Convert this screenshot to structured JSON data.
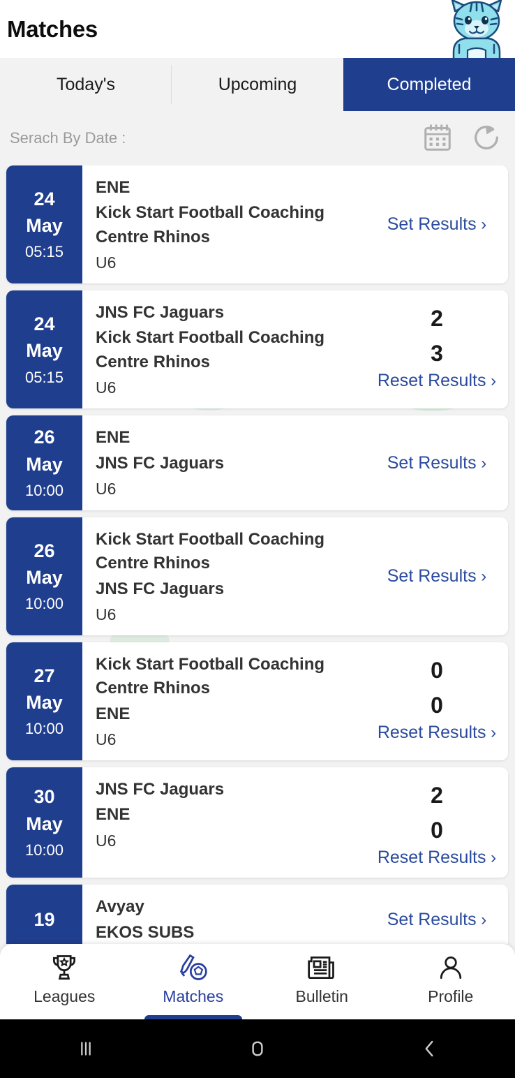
{
  "header": {
    "title": "Matches",
    "mascot_icon": "tiger-mascot-icon"
  },
  "tabs": [
    {
      "label": "Today's",
      "active": false
    },
    {
      "label": "Upcoming",
      "active": false
    },
    {
      "label": "Completed",
      "active": true
    }
  ],
  "search": {
    "label": "Serach By Date :",
    "calendar_icon": "calendar-icon",
    "refresh_icon": "refresh-icon"
  },
  "colors": {
    "primary_blue": "#1f3e8e",
    "link_blue": "#2a4a9e",
    "page_bg": "#f2f2f2",
    "card_bg": "#ffffff",
    "text_dark": "#333333"
  },
  "matches": [
    {
      "day": "24",
      "month": "May",
      "time": "05:15",
      "team_home": "ENE",
      "team_away": "Kick Start Football Coaching Centre Rhinos",
      "category": "U6",
      "score_home": null,
      "score_away": null,
      "action": "Set Results"
    },
    {
      "day": "24",
      "month": "May",
      "time": "05:15",
      "team_home": "JNS FC Jaguars",
      "team_away": "Kick Start Football Coaching Centre Rhinos",
      "category": "U6",
      "score_home": "2",
      "score_away": "3",
      "action": "Reset Results"
    },
    {
      "day": "26",
      "month": "May",
      "time": "10:00",
      "team_home": "ENE",
      "team_away": "JNS FC Jaguars",
      "category": "U6",
      "score_home": null,
      "score_away": null,
      "action": "Set Results"
    },
    {
      "day": "26",
      "month": "May",
      "time": "10:00",
      "team_home": "Kick Start Football Coaching Centre Rhinos",
      "team_away": "JNS FC Jaguars",
      "category": "U6",
      "score_home": null,
      "score_away": null,
      "action": "Set Results"
    },
    {
      "day": "27",
      "month": "May",
      "time": "10:00",
      "team_home": "Kick Start Football Coaching Centre Rhinos",
      "team_away": "ENE",
      "category": "U6",
      "score_home": "0",
      "score_away": "0",
      "action": "Reset Results"
    },
    {
      "day": "30",
      "month": "May",
      "time": "10:00",
      "team_home": "JNS FC Jaguars",
      "team_away": "ENE",
      "category": "U6",
      "score_home": "2",
      "score_away": "0",
      "action": "Reset Results"
    },
    {
      "day": "19",
      "month": "",
      "time": "",
      "team_home": "Avyay",
      "team_away": "EKOS SUBS",
      "category": "",
      "score_home": null,
      "score_away": null,
      "action": "Set Results"
    }
  ],
  "bottom_nav": [
    {
      "label": "Leagues",
      "icon": "trophy-icon",
      "active": false
    },
    {
      "label": "Matches",
      "icon": "football-icon",
      "active": true
    },
    {
      "label": "Bulletin",
      "icon": "newspaper-icon",
      "active": false
    },
    {
      "label": "Profile",
      "icon": "person-icon",
      "active": false
    }
  ],
  "system_bar": [
    {
      "name": "recents-button"
    },
    {
      "name": "home-button"
    },
    {
      "name": "back-button"
    }
  ],
  "chevron": "›"
}
